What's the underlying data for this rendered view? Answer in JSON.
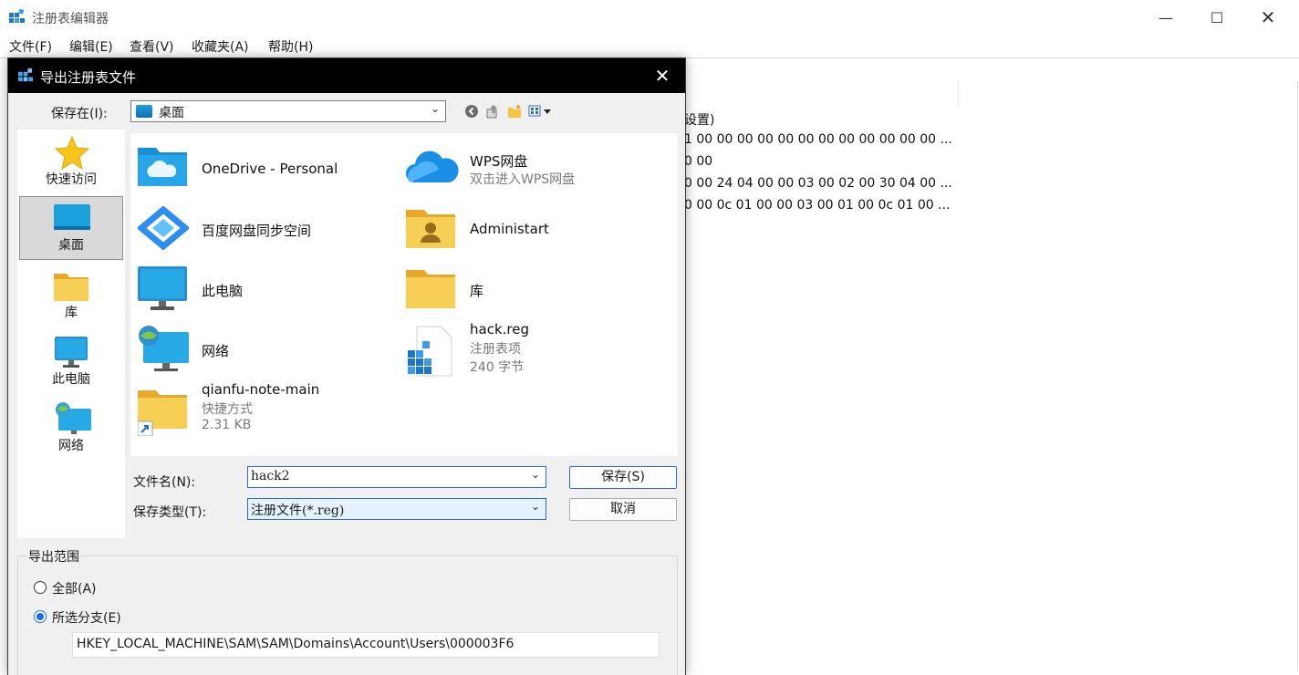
{
  "main_window": {
    "title": "注册表编辑器",
    "menu": [
      "文件(F)",
      "编辑(E)",
      "查看(V)",
      "收藏夹(A)",
      "帮助(H)"
    ],
    "value_pane_lines": [
      "设置)",
      "1 00 00 00 00 00 00 00 00 00 00 00 00 ...",
      "0 00",
      "0 00 24 04 00 00 03 00 02 00 30 04 00 ...",
      "0 00 0c 01 00 00 03 00 01 00 0c 01 00 ..."
    ]
  },
  "dialog": {
    "title": "导出注册表文件",
    "save_in_label": "保存在(I):",
    "save_in_value": "桌面",
    "places": [
      "快速访问",
      "桌面",
      "库",
      "此电脑",
      "网络"
    ],
    "selected_place": "桌面",
    "files": [
      {
        "name": "OneDrive - Personal",
        "sub1": "",
        "sub2": "",
        "icon": "onedrive-folder-icon"
      },
      {
        "name": "WPS网盘",
        "sub1": "双击进入WPS网盘",
        "sub2": "",
        "icon": "wps-cloud-icon"
      },
      {
        "name": "百度网盘同步空间",
        "sub1": "",
        "sub2": "",
        "icon": "baidu-netdisk-icon"
      },
      {
        "name": "Administart",
        "sub1": "",
        "sub2": "",
        "icon": "user-folder-icon"
      },
      {
        "name": "此电脑",
        "sub1": "",
        "sub2": "",
        "icon": "computer-icon"
      },
      {
        "name": "库",
        "sub1": "",
        "sub2": "",
        "icon": "library-folder-icon"
      },
      {
        "name": "网络",
        "sub1": "",
        "sub2": "",
        "icon": "network-icon"
      },
      {
        "name": "hack.reg",
        "sub1": "注册表项",
        "sub2": "240 字节",
        "icon": "registry-file-icon"
      },
      {
        "name": "qianfu-note-main",
        "sub1": "快捷方式",
        "sub2": "2.31 KB",
        "icon": "shortcut-folder-icon"
      }
    ],
    "filename_label": "文件名(N):",
    "filename_value": "hack2",
    "filetype_label": "保存类型(T):",
    "filetype_value": "注册文件(*.reg)",
    "save_button": "保存(S)",
    "cancel_button": "取消",
    "export_range": {
      "label": "导出范围",
      "all_label": "全部(A)",
      "branch_label": "所选分支(E)",
      "selected": "branch",
      "branch_path": "HKEY_LOCAL_MACHINE\\SAM\\SAM\\Domains\\Account\\Users\\000003F6"
    }
  },
  "colors": {
    "dialog_titlebar": "#000000",
    "accent": "#1a6fd6",
    "folder_yellow": "#f5c542"
  }
}
